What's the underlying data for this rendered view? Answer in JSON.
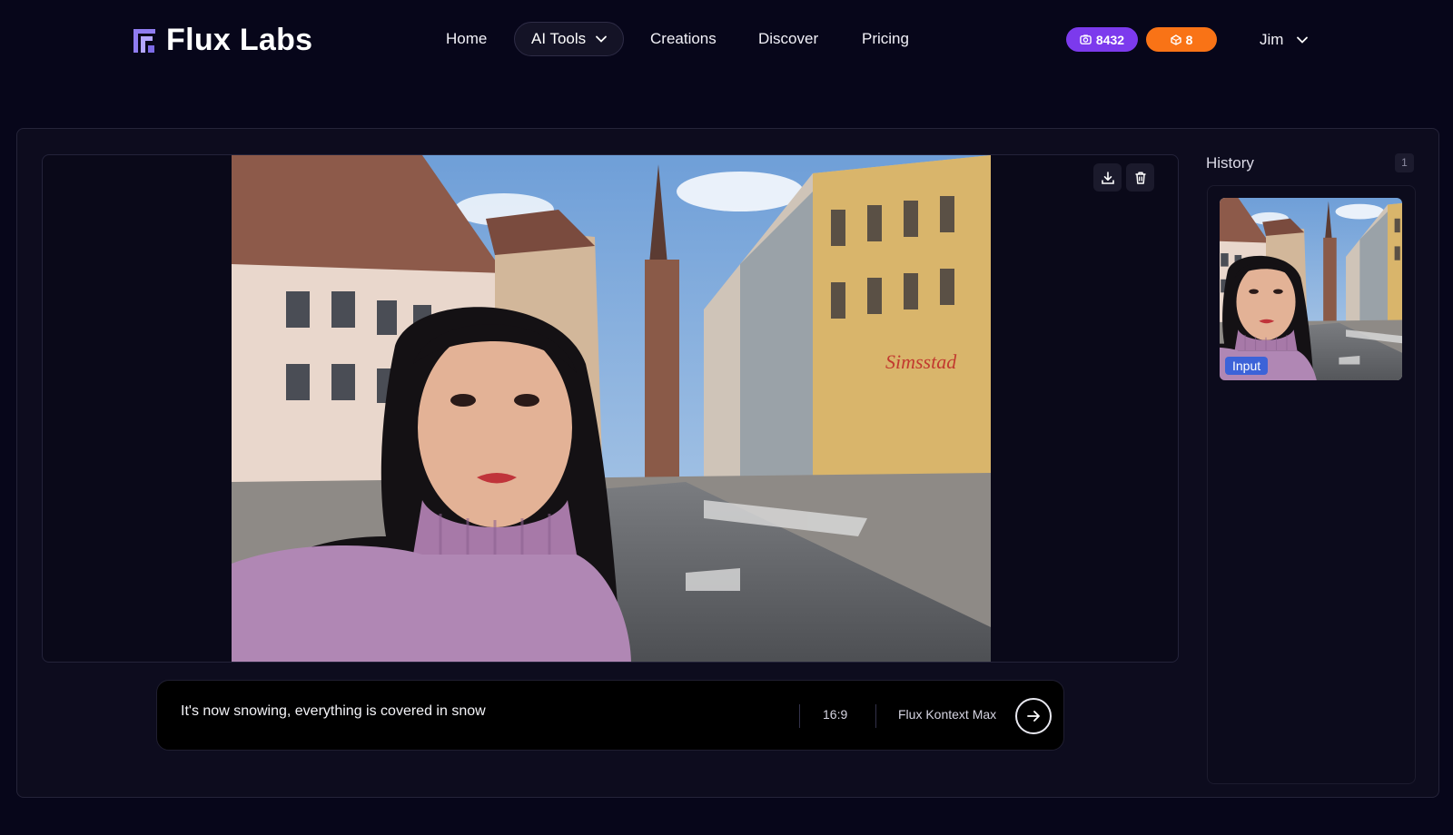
{
  "app": {
    "name": "Flux Labs"
  },
  "nav": {
    "home": "Home",
    "ai_tools": "AI Tools",
    "creations": "Creations",
    "discover": "Discover",
    "pricing": "Pricing"
  },
  "credits": {
    "image_credits": "8432",
    "gem_credits": "8",
    "image_icon": "camera-icon",
    "gem_icon": "gem-icon"
  },
  "user": {
    "name": "Jim"
  },
  "colors": {
    "background": "#07061a",
    "accent_purple": "#7c3aed",
    "accent_orange": "#f97316",
    "tag_blue": "#3c63d8"
  },
  "editor": {
    "image": "selfie-on-old-town-street",
    "prompt": "It's now snowing, everything is covered in snow",
    "aspect_ratio": "16:9",
    "model": "Flux Kontext Max"
  },
  "history": {
    "title": "History",
    "count": "1",
    "items": [
      {
        "tag": "Input"
      }
    ]
  }
}
